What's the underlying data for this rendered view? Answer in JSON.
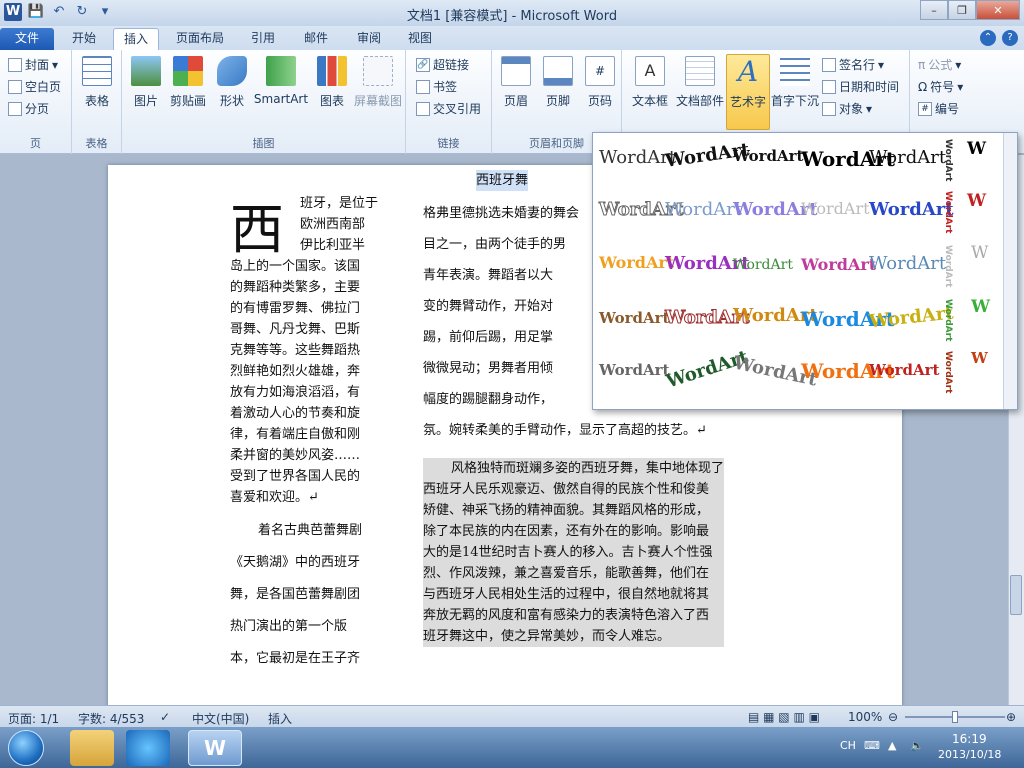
{
  "window": {
    "title": "文档1 [兼容模式] - Microsoft Word"
  },
  "quick_access": {
    "logo": "W",
    "save": "💾",
    "undo": "↶",
    "redo": "↻",
    "customize": "▾"
  },
  "tabs": [
    "文件",
    "开始",
    "插入",
    "页面布局",
    "引用",
    "邮件",
    "审阅",
    "视图"
  ],
  "ribbon": {
    "page_group": {
      "label": "页",
      "items": [
        "封面",
        "空白页",
        "分页"
      ]
    },
    "table_group": {
      "label": "表格",
      "button": "表格"
    },
    "illustrations": {
      "label": "插图",
      "buttons": [
        "图片",
        "剪贴画",
        "形状",
        "SmartArt",
        "图表",
        "屏幕截图"
      ]
    },
    "links": {
      "label": "链接",
      "items": [
        "超链接",
        "书签",
        "交叉引用"
      ]
    },
    "header_footer": {
      "label": "页眉和页脚",
      "buttons": [
        "页眉",
        "页脚",
        "页码"
      ]
    },
    "text": {
      "label": "文本",
      "buttons": [
        "文本框",
        "文档部件",
        "艺术字",
        "首字下沉"
      ],
      "items": [
        "签名行",
        "日期和时间",
        "对象"
      ]
    },
    "symbols": {
      "label": "符号",
      "items": [
        "公式",
        "符号",
        "编号"
      ]
    }
  },
  "document": {
    "dropcap": "西",
    "left_lines": [
      "班牙，是位于",
      "欧洲西南部",
      "伊比利亚半",
      "岛上的一个国家。该国",
      "的舞蹈种类繁多，主要",
      "的有博雷罗舞、佛拉门",
      "哥舞、凡丹戈舞、巴斯",
      "克舞等等。这些舞蹈热",
      "烈鲜艳如烈火雄雄，奔",
      "放有力如海浪滔滔，有",
      "着激动人心的节奏和旋",
      "律，有着端庄自傲和刚",
      "柔并窗的美妙风姿……",
      "受到了世界各国人民的",
      "喜爱和欢迎。↵"
    ],
    "left_lines2": [
      "着名古典芭蕾舞剧",
      "《天鹅湖》中的西班牙",
      "舞，是各国芭蕾舞剧团",
      "热门演出的第一个版",
      "本，它最初是在王子齐"
    ],
    "heading": "西班牙舞",
    "right_top": [
      "格弗里德挑选未婚妻的舞会",
      "目之一，由两个徒手的男",
      "青年表演。舞蹈者以大",
      "变的舞臂动作，开始对",
      "踢，前仰后踢，用足掌",
      "微微晃动；男舞者用倾",
      "幅度的踢腿翻身动作，",
      "氛。婉转柔美的手臂动作，显示了高超的技艺。↵"
    ],
    "right_para": [
      "风格独特而斑斓多姿的西班牙舞，集中地体现了",
      "西班牙人民乐观豪迈、傲然自得的民族个性和俊美",
      "矫健、神采飞扬的精神面貌。其舞蹈风格的形成，",
      "除了本民族的内在因素，还有外在的影响。影响最",
      "大的是14世纪时吉卜赛人的移入。吉卜赛人个性强",
      "烈、作风泼辣，兼之喜爱音乐，能歌善舞，他们在",
      "与西班牙人民相处生活的过程中，很自然地就将其",
      "奔放无羁的风度和富有感染力的表演特色溶入了西",
      "班牙舞这中，使之异常美妙，而令人难忘。"
    ]
  },
  "gallery": {
    "sample": "WordArt",
    "vertical_sample": "WordArt",
    "short": "W"
  },
  "status": {
    "page": "页面: 1/1",
    "words": "字数: 4/553",
    "language": "中文(中国)",
    "mode": "插入",
    "zoom": "100%"
  },
  "tray": {
    "ime": "CH",
    "time": "16:19",
    "date": "2013/10/18"
  },
  "colors": {
    "accent": "#2b579a",
    "file_tab": "#1d59b3"
  }
}
